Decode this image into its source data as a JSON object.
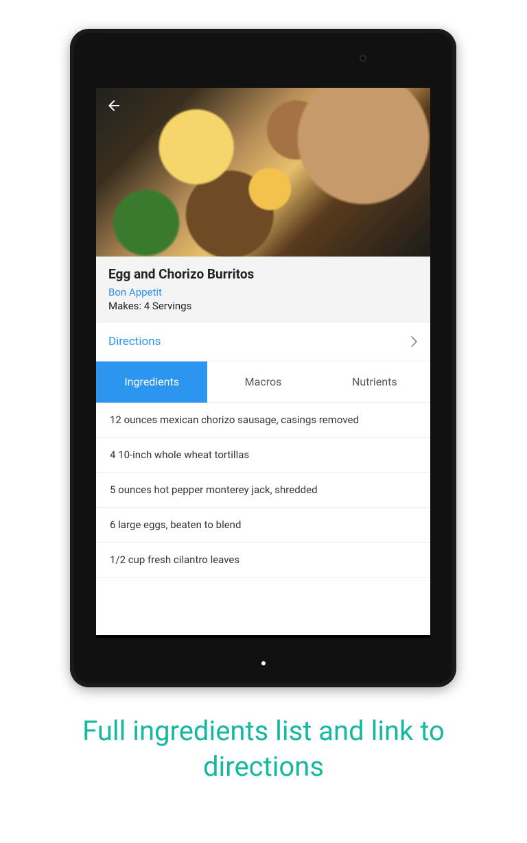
{
  "recipe": {
    "title": "Egg and Chorizo Burritos",
    "source": "Bon Appetit",
    "servings": "Makes: 4 Servings"
  },
  "directions_label": "Directions",
  "tabs": {
    "ingredients": "Ingredients",
    "macros": "Macros",
    "nutrients": "Nutrients"
  },
  "ingredients": [
    "12 ounces mexican chorizo sausage, casings removed",
    "4 10-inch whole wheat tortillas",
    "5 ounces hot pepper monterey jack, shredded",
    "6 large eggs, beaten to blend",
    "1/2 cup fresh cilantro leaves"
  ],
  "caption": "Full ingredients list and link to directions",
  "colors": {
    "accent": "#2b95ef",
    "teal": "#16b8a0"
  }
}
